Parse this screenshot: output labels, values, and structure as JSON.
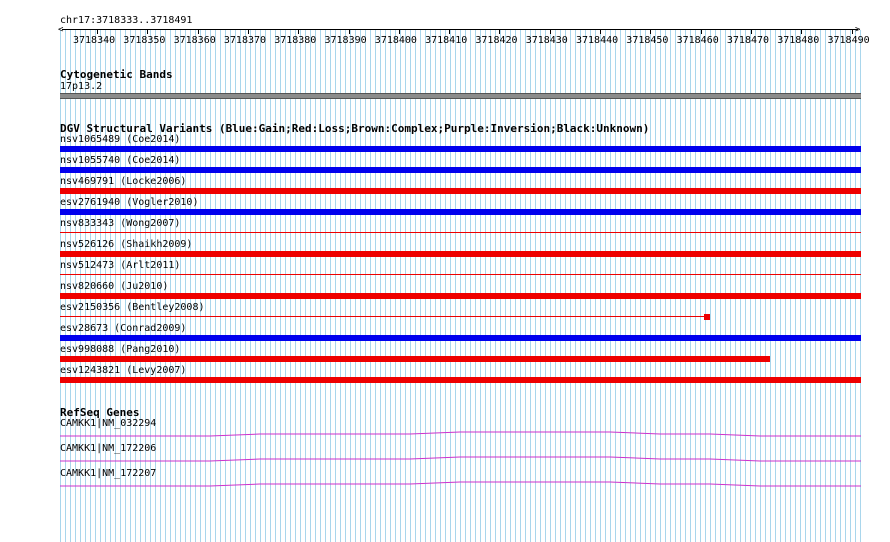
{
  "ruler": {
    "position_label": "chr17:3718333..3718491",
    "ticks": [
      "3718340",
      "3718350",
      "3718360",
      "3718370",
      "3718380",
      "3718390",
      "3718400",
      "3718410",
      "3718420",
      "3718430",
      "3718440",
      "3718450",
      "3718460",
      "3718470",
      "3718480",
      "3718490"
    ]
  },
  "cytoband": {
    "title": "Cytogenetic Bands",
    "band": "17p13.2"
  },
  "dgv": {
    "title": "DGV Structural Variants (Blue:Gain;Red:Loss;Brown:Complex;Purple:Inversion;Black:Unknown)",
    "colors": {
      "gain": "#0000ee",
      "loss": "#ee0000"
    },
    "items": [
      {
        "label": "nsv1065489 (Coe2014)"
      },
      {
        "label": "nsv1055740 (Coe2014)"
      },
      {
        "label": "nsv469791 (Locke2006)"
      },
      {
        "label": "esv2761940 (Vogler2010)"
      },
      {
        "label": "nsv833343 (Wong2007)"
      },
      {
        "label": "nsv526126 (Shaikh2009)"
      },
      {
        "label": "nsv512473 (Arlt2011)"
      },
      {
        "label": "nsv820660 (Ju2010)"
      },
      {
        "label": "esv2150356 (Bentley2008)"
      },
      {
        "label": "esv28673 (Conrad2009)"
      },
      {
        "label": "esv998088 (Pang2010)"
      },
      {
        "label": "esv1243821 (Levy2007)"
      }
    ]
  },
  "refseq": {
    "title": "RefSeq Genes",
    "color": "#cc33cc",
    "genes": [
      {
        "label": "CAMKK1|NM_032294"
      },
      {
        "label": "CAMKK1|NM_172206"
      },
      {
        "label": "CAMKK1|NM_172207"
      }
    ]
  }
}
